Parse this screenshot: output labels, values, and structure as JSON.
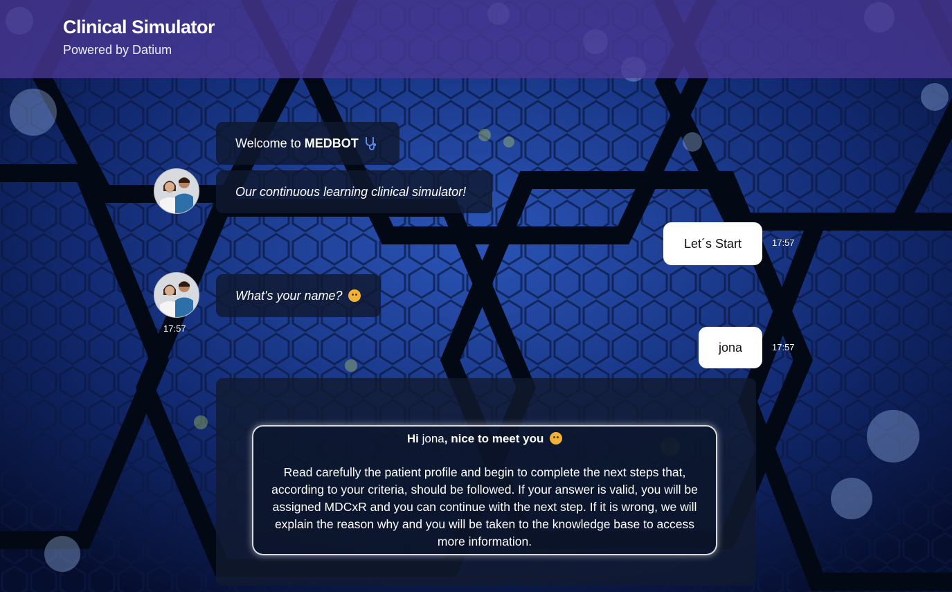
{
  "header": {
    "title": "Clinical Simulator",
    "subtitle": "Powered by Datium"
  },
  "messages": {
    "welcome_prefix": "Welcome to ",
    "welcome_bold": "MEDBOT",
    "welcome_icon": "stethoscope-icon",
    "tagline": "Our continuous learning clinical simulator!",
    "user_start": "Let´s Start",
    "user_start_time": "17:57",
    "ask_name": "What's your name?",
    "ask_name_icon": "thinking-face-emoji",
    "ask_name_time": "17:57",
    "user_name": "jona",
    "user_name_time": "17:57"
  },
  "card": {
    "greet_hi": "Hi",
    "greet_name": "jona",
    "greet_rest": ", nice to meet you",
    "greet_icon": "hugging-face-emoji",
    "body": "Read carefully the patient profile and begin to complete the next steps that, according to your criteria, should be followed. If your answer is valid, you will be assigned MDCxR  and you can continue with the next step. If it is wrong, we will explain the reason why and you will be taken to the knowledge base to access more information."
  },
  "colors": {
    "header": "#4a3896",
    "background": "#0a1a4a",
    "bot_bubble": "#101830",
    "user_bubble": "#ffffff"
  }
}
